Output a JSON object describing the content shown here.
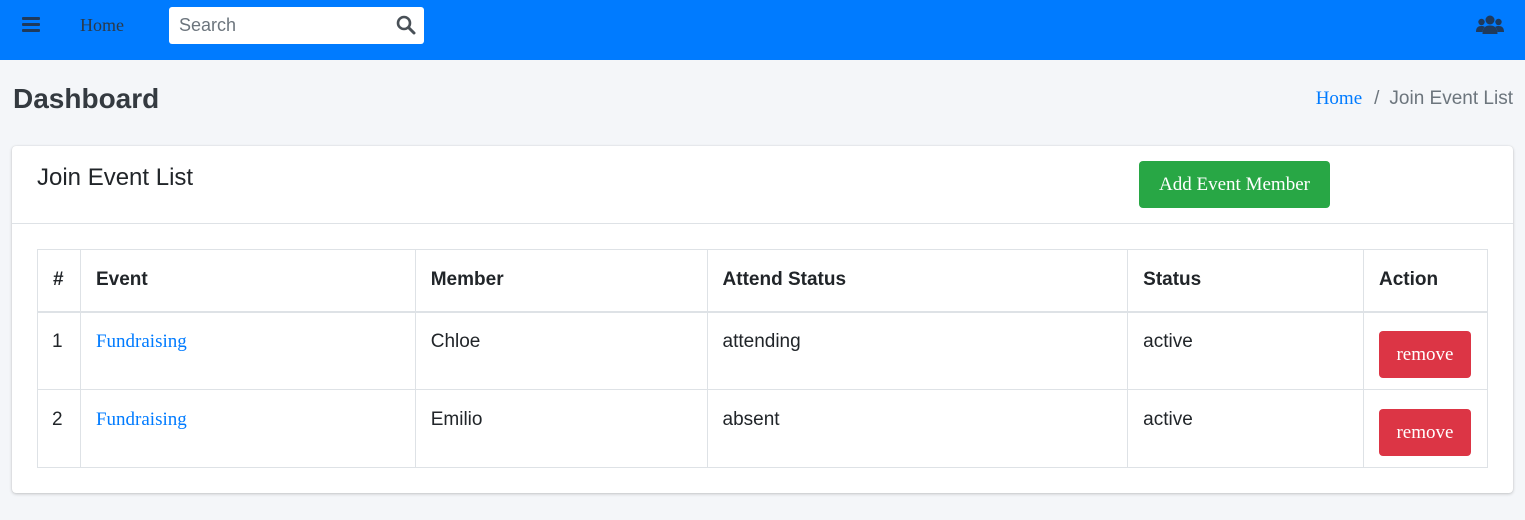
{
  "navbar": {
    "menu_icon": "hamburger-menu-icon",
    "home_label": "Home",
    "search": {
      "placeholder": "Search",
      "value": "",
      "icon": "search-icon"
    },
    "users_icon": "users-icon",
    "bg_color": "#007bff"
  },
  "page": {
    "title": "Dashboard",
    "breadcrumb": {
      "home": "Home",
      "separator": "/",
      "current": "Join Event List"
    }
  },
  "card": {
    "title": "Join Event List",
    "add_button_label": "Add Event Member",
    "add_button_color": "#28a745"
  },
  "table": {
    "headers": [
      "#",
      "Event",
      "Member",
      "Attend Status",
      "Status",
      "Action"
    ],
    "rows": [
      {
        "num": "1",
        "event": "Fundraising",
        "member": "Chloe",
        "attend_status": "attending",
        "status": "active",
        "action": "remove"
      },
      {
        "num": "2",
        "event": "Fundraising",
        "member": "Emilio",
        "attend_status": "absent",
        "status": "active",
        "action": "remove"
      }
    ],
    "remove_button_color": "#dc3545"
  }
}
